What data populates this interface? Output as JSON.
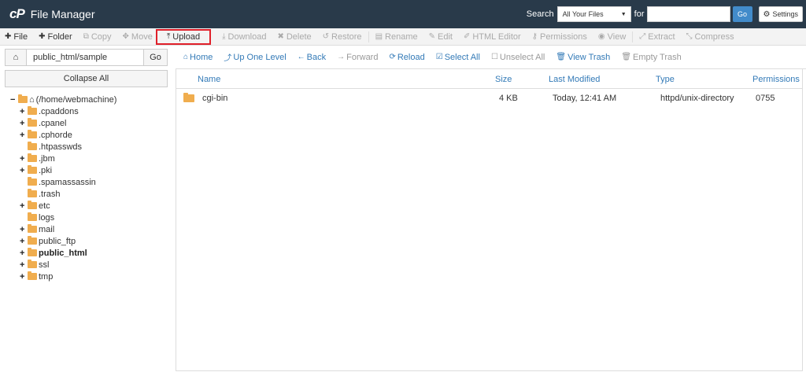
{
  "header": {
    "logo": "cP",
    "title": "File Manager",
    "search_label": "Search",
    "search_scope": "All Your Files",
    "for_label": "for",
    "search_value": "",
    "go_label": "Go",
    "settings_label": "Settings"
  },
  "toolbar": {
    "file": "File",
    "folder": "Folder",
    "copy": "Copy",
    "move": "Move",
    "upload": "Upload",
    "download": "Download",
    "delete": "Delete",
    "restore": "Restore",
    "rename": "Rename",
    "edit": "Edit",
    "html_editor": "HTML Editor",
    "permissions": "Permissions",
    "view": "View",
    "extract": "Extract",
    "compress": "Compress"
  },
  "left": {
    "path_value": "public_html/sample",
    "go_label": "Go",
    "collapse_label": "Collapse All",
    "root_label": "(/home/webmachine)",
    "tree": [
      {
        "label": ".cpaddons",
        "toggle": "+"
      },
      {
        "label": ".cpanel",
        "toggle": "+"
      },
      {
        "label": ".cphorde",
        "toggle": "+"
      },
      {
        "label": ".htpasswds",
        "toggle": ""
      },
      {
        "label": ".jbm",
        "toggle": "+"
      },
      {
        "label": ".pki",
        "toggle": "+"
      },
      {
        "label": ".spamassassin",
        "toggle": ""
      },
      {
        "label": ".trash",
        "toggle": ""
      },
      {
        "label": "etc",
        "toggle": "+"
      },
      {
        "label": "logs",
        "toggle": ""
      },
      {
        "label": "mail",
        "toggle": "+"
      },
      {
        "label": "public_ftp",
        "toggle": "+"
      },
      {
        "label": "public_html",
        "toggle": "+"
      },
      {
        "label": "ssl",
        "toggle": "+"
      },
      {
        "label": "tmp",
        "toggle": "+"
      }
    ]
  },
  "nav": {
    "home": "Home",
    "up": "Up One Level",
    "back": "Back",
    "forward": "Forward",
    "reload": "Reload",
    "select_all": "Select All",
    "unselect_all": "Unselect All",
    "view_trash": "View Trash",
    "empty_trash": "Empty Trash"
  },
  "table": {
    "columns": {
      "name": "Name",
      "size": "Size",
      "modified": "Last Modified",
      "type": "Type",
      "permissions": "Permissions"
    },
    "rows": [
      {
        "name": "cgi-bin",
        "size": "4 KB",
        "modified": "Today, 12:41 AM",
        "type": "httpd/unix-directory",
        "permissions": "0755"
      }
    ]
  },
  "colors": {
    "header_bg": "#293a4a",
    "link": "#337ab7",
    "folder": "#f0ad4e",
    "highlight": "#e0202a",
    "go_button": "#428bca"
  }
}
